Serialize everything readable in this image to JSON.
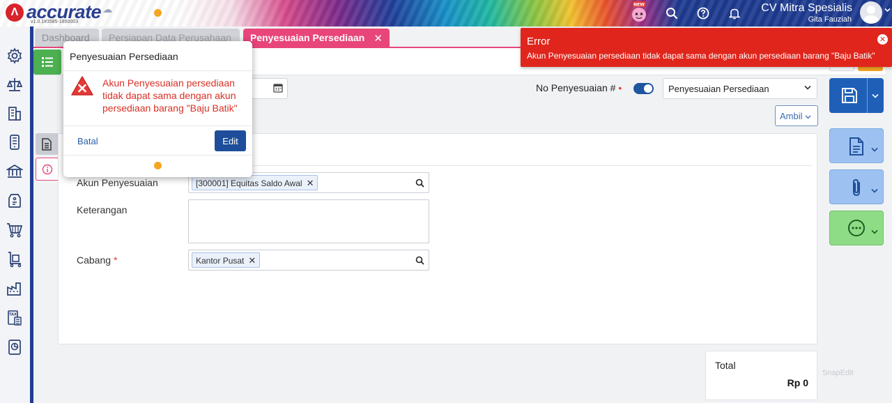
{
  "header": {
    "brand": "accurate",
    "brand_suffix": "online",
    "version": "v1.0.1#3585-1850003",
    "company": "CV Mitra Spesialis",
    "user": "Gita Fauziah",
    "new_badge": "NEW"
  },
  "tabs": [
    {
      "label": "Dashboard"
    },
    {
      "label": "Persiapan Data Perusahaan"
    },
    {
      "label": "Penyesuaian Persediaan",
      "close": "✕"
    }
  ],
  "form": {
    "no_label": "No Penyesuaian #",
    "required_mark": "•",
    "select_value": "Penyesuaian Persediaan",
    "ambil_label": "Ambil",
    "akun_label": "Akun Penyesuaian",
    "akun_value": "[300001] Equitas Saldo Awal",
    "keterangan_label": "Keterangan",
    "keterangan_value": "",
    "cabang_label": "Cabang",
    "cabang_required": "*",
    "cabang_value": "Kantor Pusat",
    "tag_remove": "✕"
  },
  "total": {
    "label": "Total",
    "value": "Rp 0"
  },
  "watermark": "SnapEdit",
  "toast": {
    "title": "Error",
    "message": "Akun Penyesuaian persediaan tidak dapat sama dengan akun persediaan barang \"Baju Batik\"",
    "close": "✕"
  },
  "dialog": {
    "title": "Penyesuaian Persediaan",
    "message": "Akun Penyesuaian persediaan tidak dapat sama dengan akun persediaan barang \"Baju Batik\"",
    "cancel_label": "Batal",
    "edit_label": "Edit"
  },
  "colors": {
    "accent_pink": "#e8457a",
    "primary_blue": "#1f5fb8",
    "error_red": "#e0261c",
    "success_green": "#4caf50",
    "warning_orange": "#f5a623"
  },
  "sidebar": {
    "icons": [
      "gear-icon",
      "scale-icon",
      "building-icon",
      "phone-icon",
      "bank-icon",
      "tag-icon",
      "cart-icon",
      "trolley-icon",
      "factory-icon",
      "tax-icon",
      "report-icon"
    ]
  }
}
